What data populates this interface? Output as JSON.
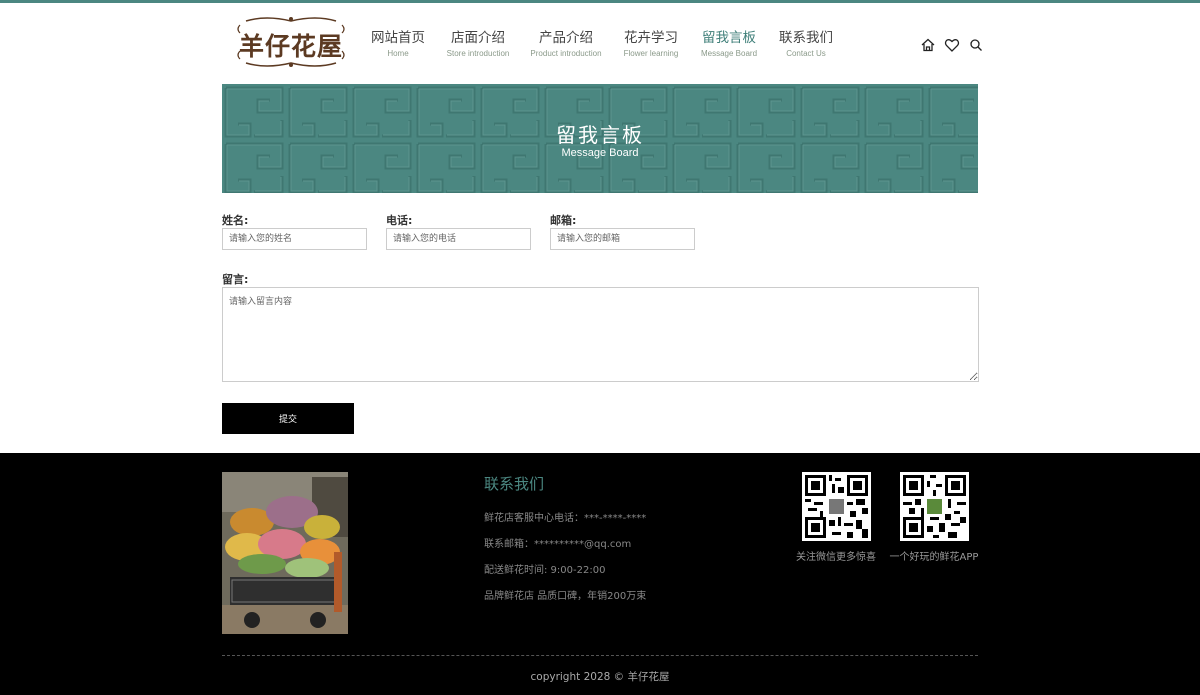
{
  "logo": {
    "text": "羊仔花屋"
  },
  "nav": [
    {
      "cn": "网站首页",
      "en": "Home"
    },
    {
      "cn": "店面介绍",
      "en": "Store introduction"
    },
    {
      "cn": "产品介绍",
      "en": "Product introduction"
    },
    {
      "cn": "花卉学习",
      "en": "Flower learning"
    },
    {
      "cn": "留我言板",
      "en": "Message Board",
      "active": true
    },
    {
      "cn": "联系我们",
      "en": "Contact Us"
    }
  ],
  "tools": [
    "home-icon",
    "heart-icon",
    "search-icon"
  ],
  "banner": {
    "title": "留我言板",
    "subtitle": "Message Board",
    "color": "#4b8781"
  },
  "form": {
    "name": {
      "label": "姓名:",
      "placeholder": "请输入您的姓名"
    },
    "phone": {
      "label": "电话:",
      "placeholder": "请输入您的电话"
    },
    "email": {
      "label": "邮箱:",
      "placeholder": "请输入您的邮箱"
    },
    "message": {
      "label": "留言:",
      "placeholder": "请输入留言内容"
    },
    "submit": "提交"
  },
  "footer": {
    "contact_title": "联系我们",
    "lines": [
      "鲜花店客服中心电话：***-****-****",
      "联系邮箱：**********@qq.com",
      "配送鲜花时间: 9:00-22:00",
      "品牌鲜花店 品质口碑，年销200万束"
    ],
    "qr1_caption": "关注微信更多惊喜",
    "qr2_caption": "一个好玩的鲜花APP",
    "copyright": "copyright 2028 © 羊仔花屋"
  }
}
